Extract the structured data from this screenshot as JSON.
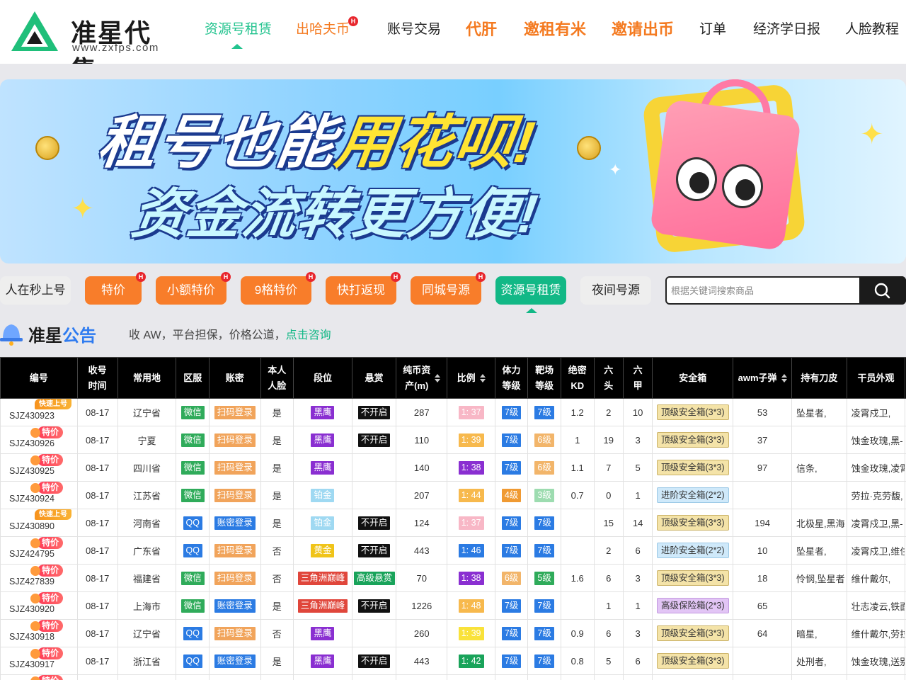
{
  "header": {
    "logo_text": "准星代售",
    "logo_sub": "www.zxfps.com",
    "nav": [
      {
        "label": "资源号租赁",
        "style": "active"
      },
      {
        "label": "出哈夫币",
        "style": "orange",
        "hot": "H"
      },
      {
        "label": "账号交易",
        "style": "normal"
      },
      {
        "label": "代肝",
        "style": "orange-big"
      },
      {
        "label": "邀租有米",
        "style": "orange-big"
      },
      {
        "label": "邀请出币",
        "style": "orange-big"
      },
      {
        "label": "订单",
        "style": "normal"
      },
      {
        "label": "经济学日报",
        "style": "normal"
      },
      {
        "label": "人脸教程",
        "style": "normal"
      }
    ]
  },
  "banner": {
    "line1_a": "租号也能",
    "line1_b": "用花呗!",
    "line2": "资金流转更方便!"
  },
  "categories": [
    {
      "label": "人在秒上号",
      "style": "plain"
    },
    {
      "label": "特价",
      "style": "orange",
      "hot": "H"
    },
    {
      "label": "小额特价",
      "style": "orange",
      "hot": "H"
    },
    {
      "label": "9格特价",
      "style": "orange",
      "hot": "H"
    },
    {
      "label": "快打返现",
      "style": "orange",
      "hot": "H"
    },
    {
      "label": "同城号源",
      "style": "orange",
      "hot": "H"
    },
    {
      "label": "资源号租赁",
      "style": "green"
    },
    {
      "label": "夜间号源",
      "style": "plain"
    }
  ],
  "search": {
    "placeholder": "根据关键词搜索商品"
  },
  "notice": {
    "title_a": "准星",
    "title_b": "公告",
    "text": "收 AW，平台担保，价格公道，",
    "link": "点击咨询"
  },
  "table": {
    "headers": [
      "编号",
      "收号\n时间",
      "常用地",
      "区服",
      "账密",
      "本人\n人脸",
      "段位",
      "悬赏",
      "纯币资\n产(m)",
      "比例",
      "体力\n等级",
      "靶场\n等级",
      "绝密\nKD",
      "六\n头",
      "六\n甲",
      "安全箱",
      "awm子弹",
      "持有刀皮",
      "干员外观"
    ],
    "rows": [
      {
        "badge": "快速上号",
        "badge_type": "fast",
        "id": "SJZ430923",
        "time": "08-17",
        "loc": "辽宁省",
        "server": "微信",
        "server_c": "wechat",
        "login": "扫码登录",
        "login_c": "scan",
        "face": "是",
        "rank": "黑鹰",
        "rank_c": "black-eagle",
        "bounty": "不开启",
        "bounty_c": "bounty-off",
        "assets": "287",
        "ratio": "1: 37",
        "ratio_c": "r-pink",
        "stam": "7级",
        "stam_c": "lv-blue",
        "range": "7级",
        "range_c": "lv-blue",
        "kd": "1.2",
        "six_h": "2",
        "six_a": "10",
        "safe": "顶级安全箱(3*3)",
        "safe_c": "",
        "awm": "53",
        "knife": "坠星者,",
        "skin": "凌霄戍卫,"
      },
      {
        "badge": "特价",
        "badge_type": "deal",
        "id": "SJZ430926",
        "time": "08-17",
        "loc": "宁夏",
        "server": "微信",
        "server_c": "wechat",
        "login": "扫码登录",
        "login_c": "scan",
        "face": "是",
        "rank": "黑鹰",
        "rank_c": "black-eagle",
        "bounty": "不开启",
        "bounty_c": "bounty-off",
        "assets": "110",
        "ratio": "1: 39",
        "ratio_c": "r-orange",
        "stam": "7级",
        "stam_c": "lv-blue",
        "range": "6级",
        "range_c": "lv-orange",
        "kd": "1",
        "six_h": "19",
        "six_a": "3",
        "safe": "顶级安全箱(3*3)",
        "safe_c": "",
        "awm": "37",
        "knife": "",
        "skin": "蚀金玫瑰,黑-"
      },
      {
        "badge": "特价",
        "badge_type": "deal",
        "id": "SJZ430925",
        "time": "08-17",
        "loc": "四川省",
        "server": "微信",
        "server_c": "wechat",
        "login": "扫码登录",
        "login_c": "scan",
        "face": "是",
        "rank": "黑鹰",
        "rank_c": "black-eagle",
        "bounty": "",
        "bounty_c": "",
        "assets": "140",
        "ratio": "1: 38",
        "ratio_c": "r-purple",
        "stam": "7级",
        "stam_c": "lv-blue",
        "range": "6级",
        "range_c": "lv-orange",
        "kd": "1.1",
        "six_h": "7",
        "six_a": "5",
        "safe": "顶级安全箱(3*3)",
        "safe_c": "",
        "awm": "97",
        "knife": "信条,",
        "skin": "蚀金玫瑰,凌霄"
      },
      {
        "badge": "特价",
        "badge_type": "deal",
        "id": "SJZ430924",
        "time": "08-17",
        "loc": "江苏省",
        "server": "微信",
        "server_c": "wechat",
        "login": "扫码登录",
        "login_c": "scan",
        "face": "是",
        "rank": "铂金",
        "rank_c": "platinum",
        "bounty": "",
        "bounty_c": "",
        "assets": "207",
        "ratio": "1: 44",
        "ratio_c": "r-orange",
        "stam": "4级",
        "stam_c": "lv-orange2",
        "range": "3级",
        "range_c": "lv-green",
        "kd": "0.7",
        "six_h": "0",
        "six_a": "1",
        "safe": "进阶安全箱(2*2)",
        "safe_c": "blue",
        "awm": "",
        "knife": "",
        "skin": "劳拉·克劳馥,"
      },
      {
        "badge": "快速上号",
        "badge_type": "fast",
        "id": "SJZ430890",
        "time": "08-17",
        "loc": "河南省",
        "server": "QQ",
        "server_c": "qq",
        "login": "账密登录",
        "login_c": "pwd",
        "face": "是",
        "rank": "铂金",
        "rank_c": "platinum",
        "bounty": "不开启",
        "bounty_c": "bounty-off",
        "assets": "124",
        "ratio": "1: 37",
        "ratio_c": "r-pink",
        "stam": "7级",
        "stam_c": "lv-blue",
        "range": "7级",
        "range_c": "lv-blue",
        "kd": "",
        "six_h": "15",
        "six_a": "14",
        "safe": "顶级安全箱(3*3)",
        "safe_c": "",
        "awm": "194",
        "knife": "北极星,黑海",
        "skin": "凌霄戍卫,黑-"
      },
      {
        "badge": "特价",
        "badge_type": "deal",
        "id": "SJZ424795",
        "time": "08-17",
        "loc": "广东省",
        "server": "QQ",
        "server_c": "qq",
        "login": "扫码登录",
        "login_c": "scan",
        "face": "否",
        "rank": "黄金",
        "rank_c": "gold",
        "bounty": "不开启",
        "bounty_c": "bounty-off",
        "assets": "443",
        "ratio": "1: 46",
        "ratio_c": "r-blue",
        "stam": "7级",
        "stam_c": "lv-blue",
        "range": "7级",
        "range_c": "lv-blue",
        "kd": "",
        "six_h": "2",
        "six_a": "6",
        "safe": "进阶安全箱(2*2)",
        "safe_c": "blue",
        "awm": "10",
        "knife": "坠星者,",
        "skin": "凌霄戍卫,维住"
      },
      {
        "badge": "特价",
        "badge_type": "deal",
        "id": "SJZ427839",
        "time": "08-17",
        "loc": "福建省",
        "server": "微信",
        "server_c": "wechat",
        "login": "扫码登录",
        "login_c": "scan",
        "face": "否",
        "rank": "三角洲巅峰",
        "rank_c": "delta",
        "bounty": "高级悬赏",
        "bounty_c": "bounty-hi",
        "assets": "70",
        "ratio": "1: 38",
        "ratio_c": "r-purple",
        "stam": "6级",
        "stam_c": "lv-orange",
        "range": "5级",
        "range_c": "lv-green2",
        "kd": "1.6",
        "six_h": "6",
        "six_a": "3",
        "safe": "顶级安全箱(3*3)",
        "safe_c": "",
        "awm": "18",
        "knife": "怜悯,坠星者",
        "skin": "维什戴尔,"
      },
      {
        "badge": "特价",
        "badge_type": "deal",
        "id": "SJZ430920",
        "time": "08-17",
        "loc": "上海市",
        "server": "微信",
        "server_c": "wechat",
        "login": "账密登录",
        "login_c": "pwd",
        "face": "是",
        "rank": "三角洲巅峰",
        "rank_c": "delta",
        "bounty": "不开启",
        "bounty_c": "bounty-off",
        "assets": "1226",
        "ratio": "1: 48",
        "ratio_c": "r-orange",
        "stam": "7级",
        "stam_c": "lv-blue",
        "range": "7级",
        "range_c": "lv-blue",
        "kd": "",
        "six_h": "1",
        "six_a": "1",
        "safe": "高级保险箱(2*3)",
        "safe_c": "purple",
        "awm": "65",
        "knife": "",
        "skin": "壮志凌云,铁面"
      },
      {
        "badge": "特价",
        "badge_type": "deal",
        "id": "SJZ430918",
        "time": "08-17",
        "loc": "辽宁省",
        "server": "QQ",
        "server_c": "qq",
        "login": "扫码登录",
        "login_c": "scan",
        "face": "否",
        "rank": "黑鹰",
        "rank_c": "black-eagle",
        "bounty": "",
        "bounty_c": "",
        "assets": "260",
        "ratio": "1: 39",
        "ratio_c": "r-yellow",
        "stam": "7级",
        "stam_c": "lv-blue",
        "range": "7级",
        "range_c": "lv-blue",
        "kd": "0.9",
        "six_h": "6",
        "six_a": "3",
        "safe": "顶级安全箱(3*3)",
        "safe_c": "",
        "awm": "64",
        "knife": "暗星,",
        "skin": "维什戴尔,劳拉"
      },
      {
        "badge": "特价",
        "badge_type": "deal",
        "id": "SJZ430917",
        "time": "08-17",
        "loc": "浙江省",
        "server": "QQ",
        "server_c": "qq",
        "login": "账密登录",
        "login_c": "pwd",
        "face": "是",
        "rank": "黑鹰",
        "rank_c": "black-eagle",
        "bounty": "不开启",
        "bounty_c": "bounty-off",
        "assets": "443",
        "ratio": "1: 42",
        "ratio_c": "r-green",
        "stam": "7级",
        "stam_c": "lv-blue",
        "range": "7级",
        "range_c": "lv-blue",
        "kd": "0.8",
        "six_h": "5",
        "six_a": "6",
        "safe": "顶级安全箱(3*3)",
        "safe_c": "",
        "awm": "",
        "knife": "处刑者,",
        "skin": "蚀金玫瑰,送别"
      },
      {
        "badge": "特价",
        "badge_type": "deal",
        "id": "",
        "time": "",
        "loc": "",
        "server": "",
        "server_c": "",
        "login": "",
        "login_c": "",
        "face": "",
        "rank": "",
        "rank_c": "",
        "bounty": "",
        "bounty_c": "",
        "assets": "",
        "ratio": "",
        "ratio_c": "",
        "stam": "",
        "stam_c": "",
        "range": "",
        "range_c": "",
        "kd": "",
        "six_h": "",
        "six_a": "",
        "safe": "",
        "safe_c": "",
        "awm": "",
        "knife": "",
        "skin": ""
      }
    ]
  }
}
